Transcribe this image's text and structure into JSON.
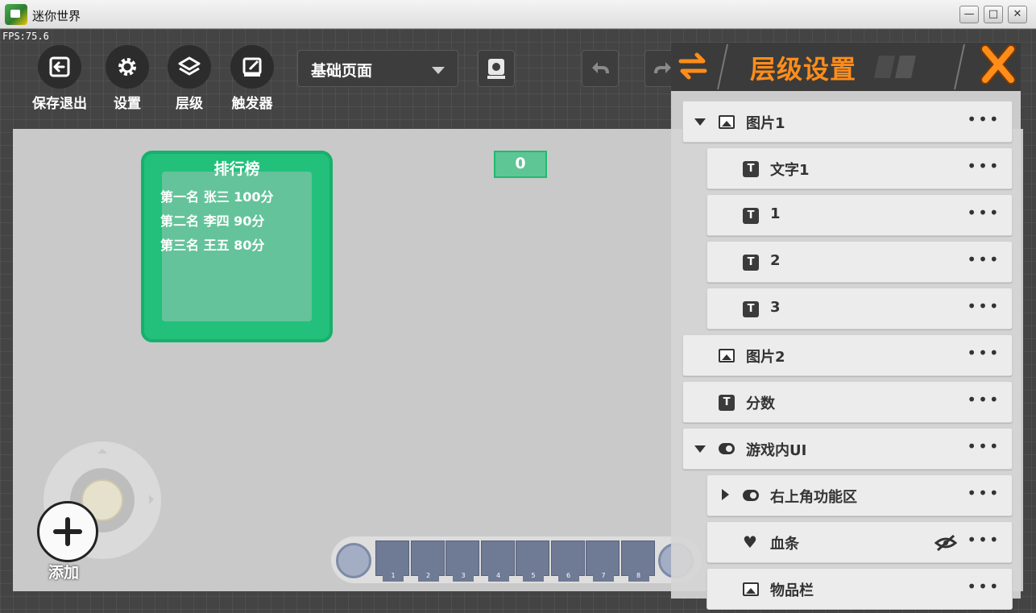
{
  "window": {
    "title": "迷你世界",
    "fps": "FPS:75.6",
    "minimize": "—",
    "maximize": "□",
    "close": "✕"
  },
  "toolbar": {
    "save_exit": "保存退出",
    "settings": "设置",
    "layers": "层级",
    "triggers": "触发器",
    "page_select": "基础页面"
  },
  "canvas": {
    "leaderboard": {
      "title": "排行榜",
      "lines": [
        "第一名 张三 100分",
        "第二名 李四 90分",
        "第三名 王五 80分"
      ]
    },
    "score_value": "0",
    "add_label": "添加",
    "hotbar_slots": [
      "1",
      "2",
      "3",
      "4",
      "5",
      "6",
      "7",
      "8"
    ]
  },
  "panel": {
    "title": "层级设置",
    "more": "•••",
    "rows": [
      {
        "label": "图片1",
        "icon": "image-icon",
        "expander": "expanded"
      },
      {
        "label": "文字1",
        "icon": "text-icon"
      },
      {
        "label": "1",
        "icon": "text-icon"
      },
      {
        "label": "2",
        "icon": "text-icon"
      },
      {
        "label": "3",
        "icon": "text-icon"
      },
      {
        "label": "图片2",
        "icon": "image-icon"
      },
      {
        "label": "分数",
        "icon": "text-icon"
      },
      {
        "label": "游戏内UI",
        "icon": "toggle-icon",
        "expander": "expanded"
      },
      {
        "label": "右上角功能区",
        "icon": "toggle-icon",
        "expander": "collapsed"
      },
      {
        "label": "血条",
        "icon": "heart-icon",
        "hidden": true
      },
      {
        "label": "物品栏",
        "icon": "image-icon"
      }
    ],
    "text_icon_glyph": "T"
  }
}
